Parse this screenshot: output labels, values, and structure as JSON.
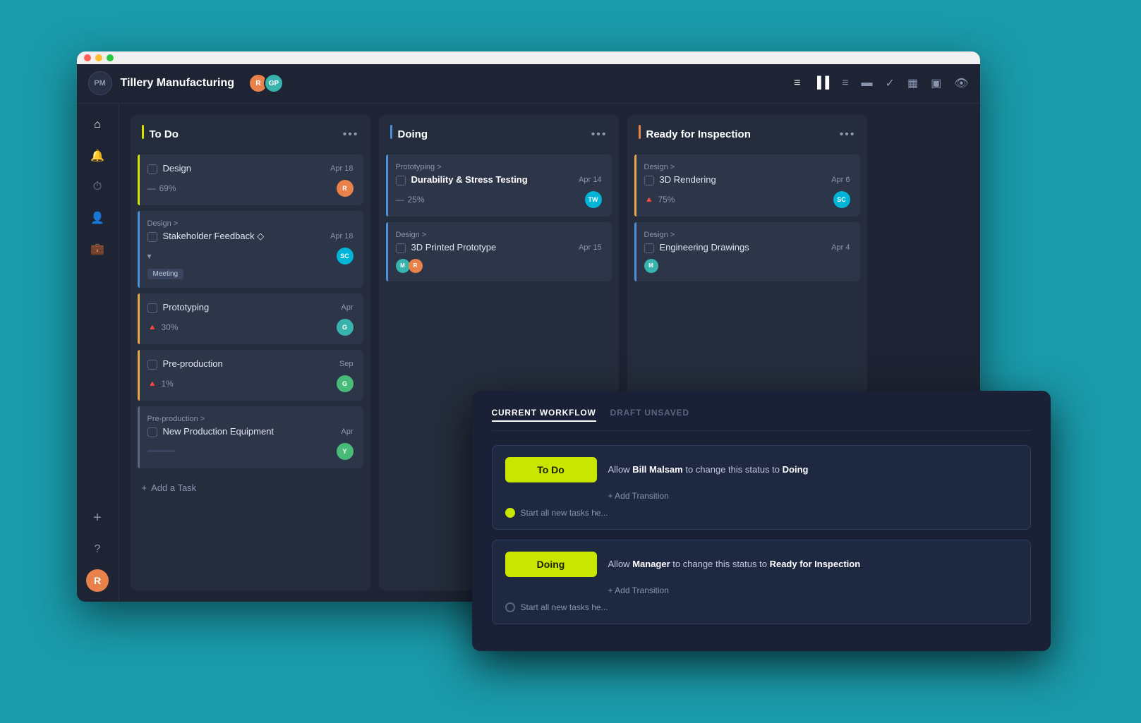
{
  "app": {
    "logo": "PM",
    "project_title": "Tillery Manufacturing",
    "avatars": [
      {
        "initials": "R",
        "color": "avatar-orange"
      },
      {
        "initials": "GP",
        "color": "avatar-teal"
      }
    ]
  },
  "header_icons": [
    "≡",
    "▐▐",
    "≡",
    "▬",
    "✓",
    "▦",
    "▣",
    "👁"
  ],
  "sidebar": {
    "icons": [
      "⌂",
      "🔔",
      "⏱",
      "👤",
      "💼",
      "+",
      "?"
    ],
    "bottom_avatar": {
      "initials": "R",
      "color": "avatar-orange"
    }
  },
  "columns": [
    {
      "id": "todo",
      "title": "To Do",
      "accent": "left-yellow",
      "accent_class": "accent-yellow",
      "tasks": [
        {
          "id": "design",
          "name": "Design",
          "date": "Apr 18",
          "progress": "69%",
          "progress_icon": "—",
          "progress_color": "#8a95b0",
          "avatar": {
            "initials": "R",
            "color": "avatar-orange"
          },
          "left_accent": "left-yellow"
        },
        {
          "id": "stakeholder",
          "name": "Stakeholder Feedback ◇",
          "date": "Apr 18",
          "parent": "Design >",
          "progress": "▾",
          "progress_icon": "▾",
          "progress_color": "#8a95b0",
          "avatar": {
            "initials": "SC",
            "color": "avatar-cyan"
          },
          "tag": "Meeting",
          "left_accent": "left-blue"
        },
        {
          "id": "prototyping",
          "name": "Prototyping",
          "date": "Apr",
          "progress": "30%",
          "progress_icon": "🔥",
          "progress_color": "#e8824a",
          "avatar": {
            "initials": "G",
            "color": "avatar-teal"
          },
          "left_accent": "left-orange"
        },
        {
          "id": "preproduction",
          "name": "Pre-production",
          "date": "Sep",
          "progress": "1%",
          "progress_icon": "🔥",
          "progress_color": "#e8824a",
          "avatar": {
            "initials": "G",
            "color": "avatar-green"
          },
          "left_accent": "left-orange"
        },
        {
          "id": "new-production",
          "name": "New Production Equipment",
          "date": "Apr",
          "parent": "Pre-production >",
          "progress": "",
          "avatar": {
            "initials": "Y",
            "color": "avatar-green"
          },
          "left_accent": "left-gray"
        }
      ],
      "add_task_label": "Add a Task"
    },
    {
      "id": "doing",
      "title": "Doing",
      "accent": "left-blue",
      "accent_class": "accent-blue",
      "tasks": [
        {
          "id": "durability",
          "name": "Durability & Stress Testing",
          "date": "Apr 14",
          "parent": "Prototyping >",
          "progress": "25%",
          "progress_icon": "—",
          "progress_color": "#8a95b0",
          "avatar": {
            "initials": "TW",
            "color": "avatar-cyan"
          },
          "left_accent": "left-blue",
          "bold": true
        },
        {
          "id": "3d-printed",
          "name": "3D Printed Prototype",
          "date": "Apr 15",
          "parent": "Design >",
          "progress": "",
          "avatar": {
            "initials": "M",
            "color": "avatar-teal"
          },
          "left_accent": "left-blue"
        }
      ]
    },
    {
      "id": "ready",
      "title": "Ready for Inspection",
      "accent": "left-orange",
      "accent_class": "accent-orange",
      "tasks": [
        {
          "id": "3d-rendering",
          "name": "3D Rendering",
          "date": "Apr 6",
          "parent": "Design >",
          "progress": "75%",
          "progress_icon": "🔥",
          "progress_color": "#e8824a",
          "avatar": {
            "initials": "SC",
            "color": "avatar-cyan"
          },
          "left_accent": "left-orange"
        },
        {
          "id": "engineering",
          "name": "Engineering Drawings",
          "date": "Apr 4",
          "parent": "Design >",
          "progress": "",
          "avatar": {
            "initials": "M",
            "color": "avatar-teal"
          },
          "left_accent": "left-blue"
        }
      ]
    }
  ],
  "modal": {
    "tabs": [
      {
        "id": "current",
        "label": "CURRENT WORKFLOW",
        "active": true
      },
      {
        "id": "draft",
        "label": "DRAFT UNSAVED",
        "active": false
      }
    ],
    "workflow_cards": [
      {
        "id": "todo-card",
        "status_label": "To Do",
        "transition_text": "Allow ",
        "transition_person": "Bill Malsam",
        "transition_middle": " to change this status to ",
        "transition_target": "Doing",
        "add_transition_label": "+ Add Transition",
        "start_label": "Start all new tasks he...",
        "dot_filled": true
      },
      {
        "id": "doing-card",
        "status_label": "Doing",
        "transition_text": "Allow ",
        "transition_person": "Manager",
        "transition_middle": " to change this status to ",
        "transition_target": "Ready for Inspection",
        "add_transition_label": "+ Add Transition",
        "start_label": "Start all new tasks he...",
        "dot_filled": false
      }
    ]
  }
}
